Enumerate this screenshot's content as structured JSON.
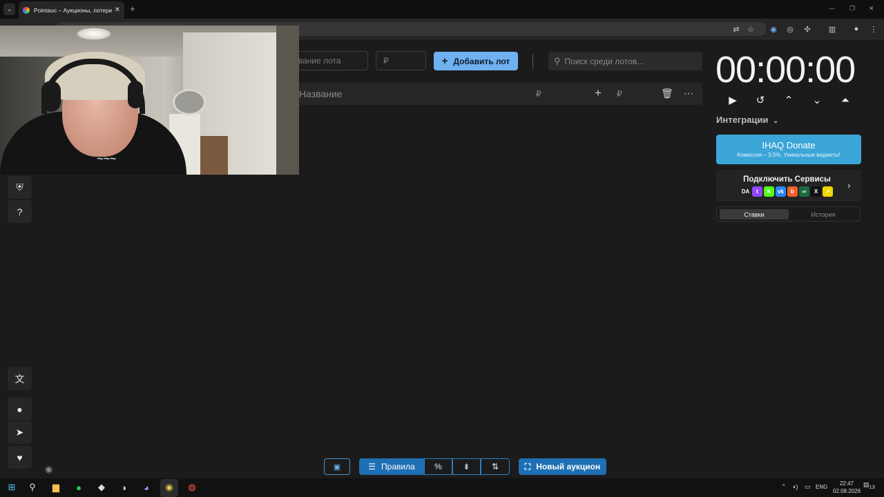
{
  "browser": {
    "tab_title": "Pointauc – Аукционы, лотереи",
    "tab_close": "✕",
    "new_tab": "+"
  },
  "toolbar": {
    "lot_name_placeholder": "Название лота",
    "lot_amount_placeholder": "₽",
    "add_lot_label": "Добавить лот",
    "search_placeholder": "Поиск среди лотов..."
  },
  "lot_row": {
    "name": "Название",
    "amount_symbol": "₽",
    "add_symbol": "₽"
  },
  "timer": {
    "value": "00:00:00"
  },
  "integrations": {
    "label": "Интеграции",
    "donate": {
      "title": "IHAQ Donate",
      "subtitle": "Комиссия – 3,5%. Уникальные виджеты!"
    },
    "connect": {
      "title": "Подключить Сервисы",
      "services": [
        {
          "name": "DA",
          "label": "DA",
          "color": "#222222"
        },
        {
          "name": "twitch",
          "label": "t",
          "color": "#9146ff"
        },
        {
          "name": "kick",
          "label": "K",
          "color": "#53fc18"
        },
        {
          "name": "vk",
          "label": "vk",
          "color": "#2787f5"
        },
        {
          "name": "boosty",
          "label": "b",
          "color": "#f15f2c"
        },
        {
          "name": "goodgame",
          "label": "∞",
          "color": "#1d6b3f"
        },
        {
          "name": "x",
          "label": "X",
          "color": "#111111"
        },
        {
          "name": "other",
          "label": "↗",
          "color": "#f2d600"
        }
      ]
    }
  },
  "history_tabs": {
    "bids": "Ставки",
    "history": "История"
  },
  "bottom_bar": {
    "rules_label": "Правила",
    "percent_symbol": "%",
    "new_auction_label": "Новый аукцион"
  },
  "taskbar": {
    "lang": "ENG",
    "time": "22:47",
    "date": "02.08.2026",
    "notifications": "13"
  },
  "colors": {
    "accent": "#6fb0f0",
    "primary": "#1e6fb3",
    "donate": "#3ba5d8"
  }
}
